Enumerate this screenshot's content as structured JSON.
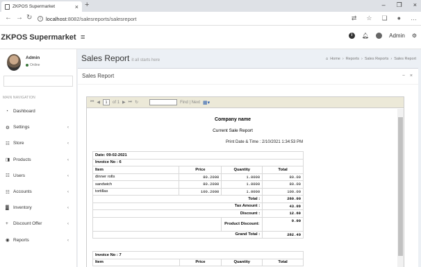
{
  "browser": {
    "tab_title": "ZKPOS Supermarket",
    "url_host": "localhost",
    "url_path": ":8082/salesreports/salesreport"
  },
  "app": {
    "logo": "ZKPOS Supermarket",
    "user": "Admin"
  },
  "sidebar": {
    "user_name": "Admin",
    "user_status": "Online",
    "nav_header": "MAIN NAVIGATION",
    "items": [
      {
        "label": "Dashboard",
        "icon": "dashboard-icon",
        "glyph": "◔",
        "expandable": false
      },
      {
        "label": "Settings",
        "icon": "gear-icon",
        "glyph": "⚙",
        "expandable": true
      },
      {
        "label": "Store",
        "icon": "users-icon",
        "glyph": "☷",
        "expandable": true
      },
      {
        "label": "Products",
        "icon": "product-icon",
        "glyph": "◨",
        "expandable": true
      },
      {
        "label": "Users",
        "icon": "users-icon",
        "glyph": "☷",
        "expandable": true
      },
      {
        "label": "Accounts",
        "icon": "users-icon",
        "glyph": "☷",
        "expandable": true
      },
      {
        "label": "Inventory",
        "icon": "chart-icon",
        "glyph": "▓",
        "expandable": true
      },
      {
        "label": "Discount Offer",
        "icon": "plus-icon",
        "glyph": "+",
        "expandable": true
      },
      {
        "label": "Reports",
        "icon": "eye-icon",
        "glyph": "◉",
        "expandable": true
      }
    ]
  },
  "page": {
    "title": "Sales Report",
    "subtitle": "it all starts here",
    "breadcrumbs": [
      "Home",
      "Reports",
      "Sales Reports",
      "Sales Report"
    ],
    "box_title": "Sales Report"
  },
  "viewer": {
    "page_current": "1",
    "page_of": "of 1",
    "find_label": "Find | Next"
  },
  "report": {
    "company": "Company name",
    "title": "Current Sale Report",
    "printed": "Print Date & Time : 2/10/2021 1:34:53 PM",
    "date": "Date: 09-02-2021",
    "headers": [
      "Item",
      "Price",
      "Quantity",
      "Total"
    ],
    "invoice1": {
      "label": "Invoice No : 6",
      "rows": [
        {
          "item": "dinner rolls",
          "price": "80.2000",
          "qty": "1.0000",
          "total": "80.00"
        },
        {
          "item": "sandwich",
          "price": "80.2000",
          "qty": "1.0000",
          "total": "80.00"
        },
        {
          "item": "tortillas",
          "price": "100.2000",
          "qty": "1.0000",
          "total": "100.00"
        }
      ],
      "total_label": "Total :",
      "total": "260.00",
      "tax_label": "Tax Amount :",
      "tax": "43.09",
      "discount_label": "Discount :",
      "discount": "12.60",
      "product_discount_label": "Product Discount:",
      "product_discount": "0.00",
      "grand_label": "Grand Total :",
      "grand": "282.49"
    },
    "invoice2": {
      "label": "Invoice No : 7"
    }
  }
}
